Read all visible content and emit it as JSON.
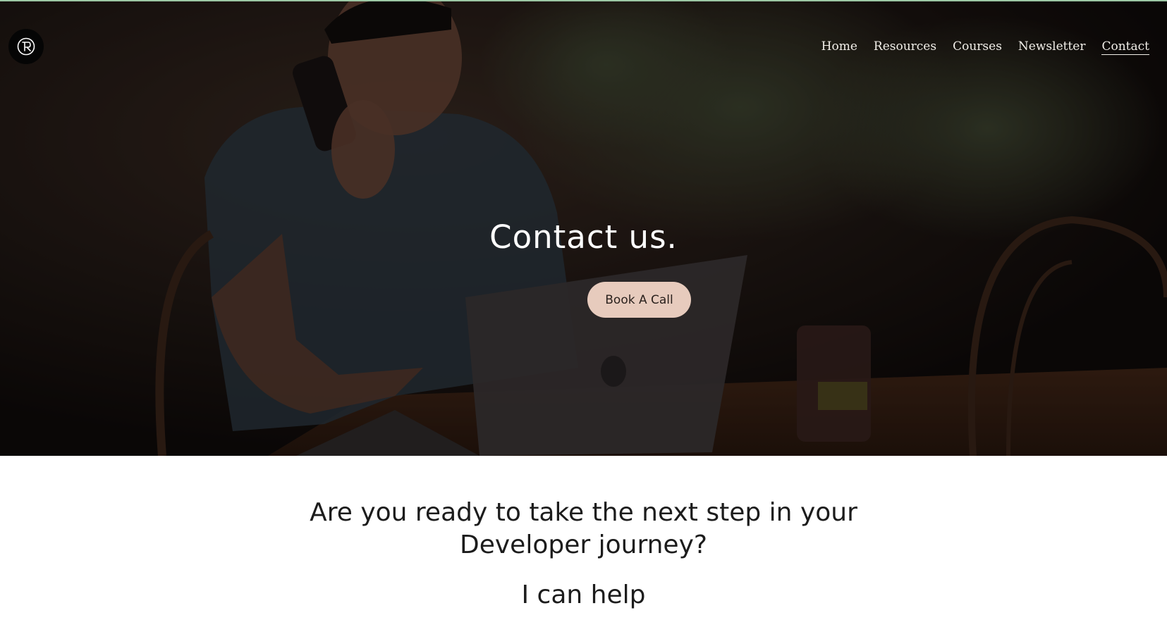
{
  "header": {
    "logo_alt": "R logo",
    "nav": [
      {
        "label": "Home",
        "active": false
      },
      {
        "label": "Resources",
        "active": false
      },
      {
        "label": "Courses",
        "active": false
      },
      {
        "label": "Newsletter",
        "active": false
      },
      {
        "label": "Contact",
        "active": true
      }
    ]
  },
  "hero": {
    "title": "Contact us.",
    "cta_label": "Book A Call",
    "background_image": "man-on-phone-at-cafe-with-laptop"
  },
  "content": {
    "lead_line1": "Are you ready to take the next step in your",
    "lead_line2": "Developer journey?",
    "subheading": "I can help"
  },
  "colors": {
    "accent_line": "#9cc7a4",
    "cta_background": "#e7cbbd",
    "nav_text": "#f2efe9",
    "body_text": "#1c1c1c"
  }
}
